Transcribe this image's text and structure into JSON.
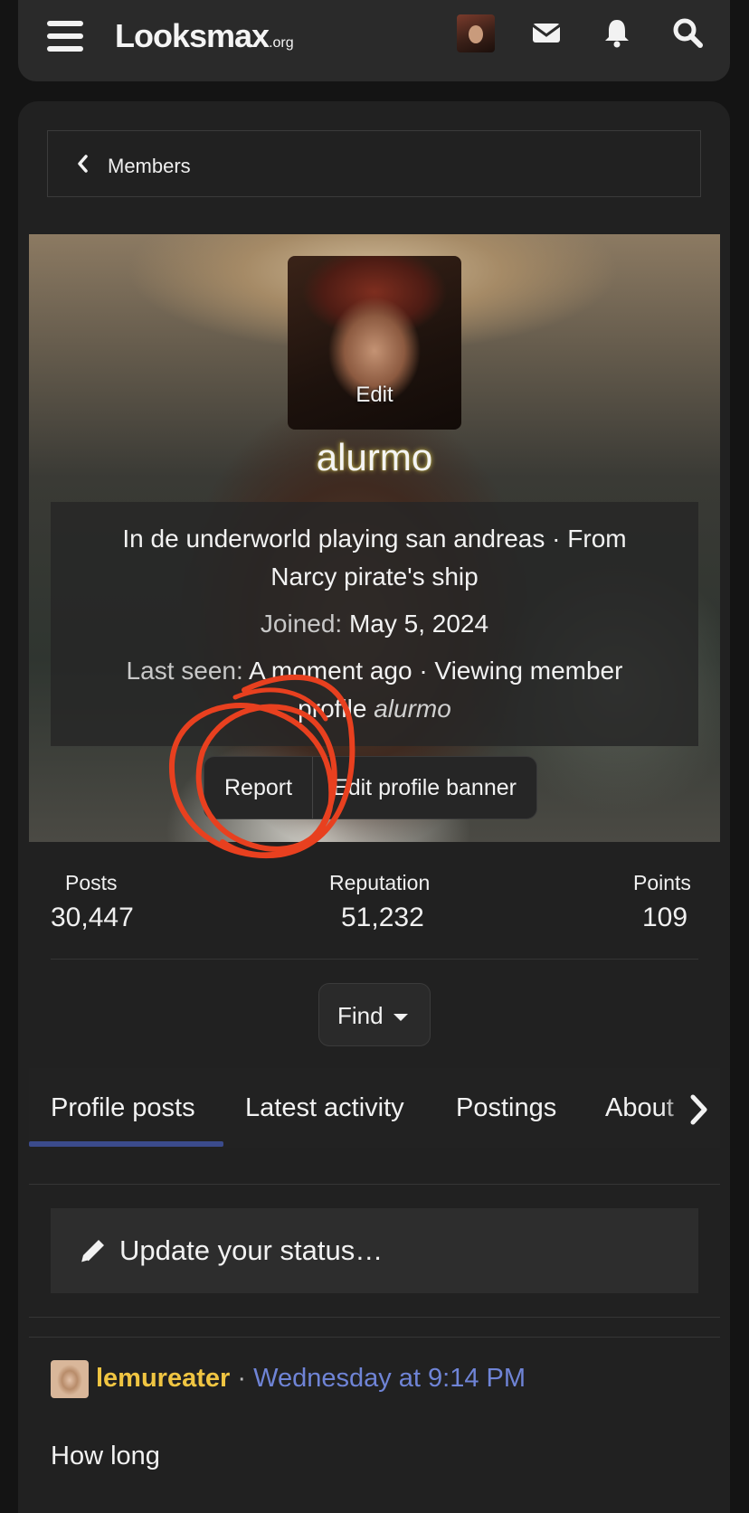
{
  "header": {
    "logo_main": "Looksmax",
    "logo_suffix": ".org",
    "icons": [
      "menu-icon",
      "envelope-icon",
      "bell-icon",
      "search-icon"
    ]
  },
  "breadcrumb": {
    "label": "Members"
  },
  "profile": {
    "avatar_edit_label": "Edit",
    "username": "alurmo",
    "status_line1": "In de underworld playing san andreas · From",
    "status_line2": "Narcy pirate's ship",
    "joined_label": "Joined:",
    "joined_value": "May 5, 2024",
    "last_seen_label": "Last seen:",
    "last_seen_value": "A moment ago · Viewing member",
    "last_seen_value2": "profile",
    "last_seen_target": "alurmo",
    "username_glow_color": "#c7b84a"
  },
  "actions": {
    "report_label": "Report",
    "edit_banner_label": "Edit profile banner"
  },
  "stats": {
    "posts_label": "Posts",
    "posts_value": "30,447",
    "reputation_label": "Reputation",
    "reputation_value": "51,232",
    "points_label": "Points",
    "points_value": "109"
  },
  "find": {
    "label": "Find"
  },
  "tabs": {
    "items": [
      "Profile posts",
      "Latest activity",
      "Postings",
      "About"
    ],
    "active": "Profile posts",
    "accent": "#3b4b8c"
  },
  "status_update": {
    "placeholder": "Update your status…"
  },
  "post": {
    "username": "lemureater",
    "separator": "·",
    "time": "Wednesday at 9:14 PM",
    "body": "How long",
    "username_color": "#f0c542",
    "time_color": "#6f84d6"
  }
}
